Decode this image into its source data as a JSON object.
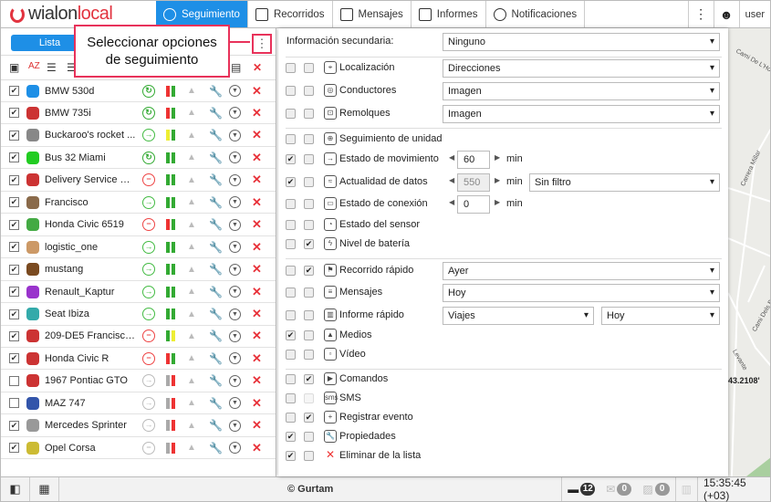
{
  "header": {
    "logo": "wialonlocal",
    "tabs": [
      {
        "label": "Seguimiento",
        "active": true
      },
      {
        "label": "Recorridos"
      },
      {
        "label": "Mensajes"
      },
      {
        "label": "Informes"
      },
      {
        "label": "Notificaciones"
      }
    ],
    "more": "⋮",
    "user": "user"
  },
  "left": {
    "tab_label": "Lista",
    "kebab": "⋮"
  },
  "callout": {
    "line1": "Seleccionar opciones",
    "line2": "de seguimiento"
  },
  "units": [
    {
      "name": "BMW 530d",
      "checked": true,
      "icon": "#1e8fe6",
      "motion": "refresh",
      "bars": [
        "red",
        "green"
      ]
    },
    {
      "name": "BMW 735i",
      "checked": true,
      "icon": "#c33",
      "motion": "refresh",
      "bars": [
        "red",
        "green"
      ]
    },
    {
      "name": "Buckaroo's rocket ...",
      "checked": true,
      "icon": "#888",
      "motion": "arrow",
      "bars": [
        "yellow",
        "green"
      ]
    },
    {
      "name": "Bus 32 Miami",
      "checked": true,
      "icon": "#2c2",
      "motion": "refresh",
      "bars": [
        "green",
        "green"
      ]
    },
    {
      "name": "Delivery Service Mi...",
      "checked": true,
      "icon": "#c33",
      "motion": "stop",
      "bars": [
        "green",
        "green"
      ]
    },
    {
      "name": "Francisco",
      "checked": true,
      "icon": "#8a6a4a",
      "motion": "arrow",
      "bars": [
        "green",
        "green"
      ]
    },
    {
      "name": "Honda Civic 6519",
      "checked": true,
      "icon": "#4a4",
      "motion": "stop",
      "bars": [
        "red",
        "green"
      ]
    },
    {
      "name": "logistic_one",
      "checked": true,
      "icon": "#c96",
      "motion": "arrow",
      "bars": [
        "green",
        "green"
      ]
    },
    {
      "name": "mustang",
      "checked": true,
      "icon": "#7a4a20",
      "motion": "arrow",
      "bars": [
        "green",
        "green"
      ]
    },
    {
      "name": "Renault_Kaptur",
      "checked": true,
      "icon": "#93c",
      "motion": "arrow",
      "bars": [
        "green",
        "green"
      ]
    },
    {
      "name": "Seat Ibiza",
      "checked": true,
      "icon": "#3aa",
      "motion": "arrow",
      "bars": [
        "green",
        "green"
      ]
    },
    {
      "name": "209-DE5 Francisco...",
      "checked": true,
      "icon": "#c33",
      "motion": "stop",
      "bars": [
        "green",
        "yellow"
      ]
    },
    {
      "name": "Honda Civic R",
      "checked": true,
      "icon": "#c33",
      "motion": "stop",
      "bars": [
        "red",
        "green"
      ]
    },
    {
      "name": "1967 Pontiac GTO",
      "checked": false,
      "icon": "#c33",
      "motion": "arrow-grey",
      "bars": [
        "grey",
        "red"
      ]
    },
    {
      "name": "MAZ 747",
      "checked": false,
      "icon": "#35a",
      "motion": "arrow-grey",
      "bars": [
        "grey",
        "red"
      ]
    },
    {
      "name": "Mercedes Sprinter",
      "checked": true,
      "icon": "#999",
      "motion": "arrow-grey",
      "bars": [
        "grey",
        "red"
      ]
    },
    {
      "name": "Opel Corsa",
      "checked": true,
      "icon": "#cb3",
      "motion": "stop-grey",
      "bars": [
        "grey",
        "red"
      ]
    }
  ],
  "options": {
    "secondary_label": "Información secundaria:",
    "secondary_value": "Ninguno",
    "min": "min",
    "rows": [
      {
        "label": "Localización",
        "c1": false,
        "c2": false,
        "icon": "⌖",
        "select": "Direcciones"
      },
      {
        "label": "Conductores",
        "c1": false,
        "c2": false,
        "icon": "◎",
        "select": "Imagen"
      },
      {
        "label": "Remolques",
        "c1": false,
        "c2": false,
        "icon": "⊡",
        "select": "Imagen"
      },
      {
        "label": "Seguimiento de unidad",
        "c1": false,
        "c2": false,
        "icon": "⊕"
      },
      {
        "label": "Estado de movimiento",
        "c1": true,
        "c2": false,
        "icon": "→",
        "num": "60"
      },
      {
        "label": "Actualidad de datos",
        "c1": true,
        "c2": false,
        "icon": "≈",
        "num": "550",
        "numDisabled": true,
        "select": "Sin filtro"
      },
      {
        "label": "Estado de conexión",
        "c1": false,
        "c2": false,
        "icon": "▭",
        "num": "0"
      },
      {
        "label": "Estado del sensor",
        "c1": false,
        "c2": false,
        "icon": "◔"
      },
      {
        "label": "Nivel de batería",
        "c1": false,
        "c2": true,
        "icon": "ϟ"
      },
      {
        "label": "Recorrido rápido",
        "c1": false,
        "c2": true,
        "icon": "⚑",
        "select": "Ayer"
      },
      {
        "label": "Mensajes",
        "c1": false,
        "c2": false,
        "icon": "≡",
        "select": "Hoy"
      },
      {
        "label": "Informe rápido",
        "c1": false,
        "c2": false,
        "icon": "▥",
        "select": "Viajes",
        "select2": "Hoy"
      },
      {
        "label": "Medios",
        "c1": true,
        "c2": false,
        "icon": "▲"
      },
      {
        "label": "Vídeo",
        "c1": false,
        "c2": false,
        "icon": "▫"
      },
      {
        "label": "Comandos",
        "c1": false,
        "c2": true,
        "icon": "▶"
      },
      {
        "label": "SMS",
        "c1": false,
        "c2": false,
        "c2Disabled": true,
        "icon": "sms"
      },
      {
        "label": "Registrar evento",
        "c1": false,
        "c2": true,
        "icon": "+"
      },
      {
        "label": "Propiedades",
        "c1": true,
        "c2": false,
        "icon": "🔧"
      },
      {
        "label": "Eliminar de la lista",
        "c1": true,
        "c2": false,
        "icon": "✕"
      }
    ]
  },
  "map": {
    "labels": [
      "Cami De L'Ho",
      "Carrera Millar",
      "Cami Dels Ba",
      "Levante",
      "43.2108'"
    ]
  },
  "footer": {
    "copyright": "© Gurtam",
    "events_count": "12",
    "messages_count": "0",
    "media_count": "0",
    "time": "15:35:45 (+03)"
  }
}
